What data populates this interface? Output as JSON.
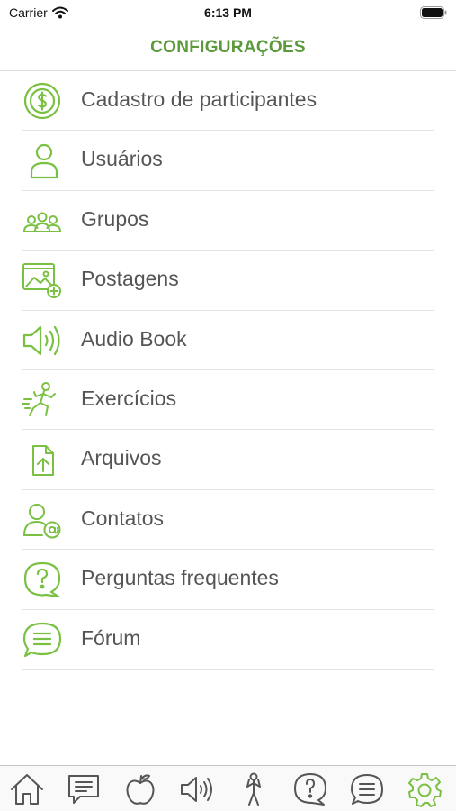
{
  "status_bar": {
    "carrier": "Carrier",
    "time": "6:13 PM"
  },
  "header": {
    "title": "CONFIGURAÇÕES"
  },
  "accent_color": "#7ac143",
  "menu": [
    {
      "label": "Cadastro de participantes",
      "icon": "dollar-coin-icon"
    },
    {
      "label": "Usuários",
      "icon": "user-icon"
    },
    {
      "label": "Grupos",
      "icon": "group-icon"
    },
    {
      "label": "Postagens",
      "icon": "image-add-icon"
    },
    {
      "label": "Audio Book",
      "icon": "speaker-icon"
    },
    {
      "label": "Exercícios",
      "icon": "runner-icon"
    },
    {
      "label": "Arquivos",
      "icon": "file-upload-icon"
    },
    {
      "label": "Contatos",
      "icon": "contact-at-icon"
    },
    {
      "label": "Perguntas frequentes",
      "icon": "question-bubble-icon"
    },
    {
      "label": "Fórum",
      "icon": "forum-icon"
    }
  ],
  "tab_bar": [
    {
      "icon": "home-icon",
      "active": false
    },
    {
      "icon": "message-icon",
      "active": false
    },
    {
      "icon": "apple-icon",
      "active": false
    },
    {
      "icon": "speaker-icon",
      "active": false
    },
    {
      "icon": "exercise-icon",
      "active": false
    },
    {
      "icon": "question-icon",
      "active": false
    },
    {
      "icon": "chat-icon",
      "active": false
    },
    {
      "icon": "gear-icon",
      "active": true
    }
  ]
}
